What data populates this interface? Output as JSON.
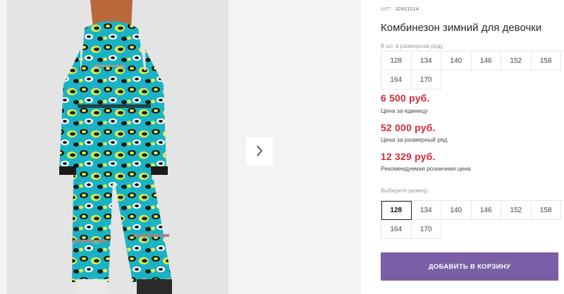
{
  "product": {
    "sku_label": "АРТ:",
    "sku_value": "32421014",
    "title": "Комбинезон зимний для девочки"
  },
  "pack_sizes": {
    "label": "В шт. в размерном ряду",
    "sizes": [
      "128",
      "134",
      "140",
      "146",
      "152",
      "158",
      "164",
      "170"
    ]
  },
  "prices": {
    "unit_price": "6 500 руб.",
    "unit_caption": "Цена за единицу",
    "row_price": "52 000 руб.",
    "row_caption": "Цена за размерный ряд",
    "retail_price": "12 329 руб.",
    "retail_caption": "Рекомендуемая розничная цена"
  },
  "size_select": {
    "label": "Выберите размер:",
    "selected": "128",
    "sizes": [
      "128",
      "134",
      "140",
      "146",
      "152",
      "158",
      "164",
      "170"
    ]
  },
  "cart": {
    "button_label": "ДОБАВИТЬ В КОРЗИНУ"
  },
  "gallery": {
    "next_icon": "chevron-right-icon"
  },
  "colors": {
    "price": "#d42a3a",
    "cart_button": "#7a5fa6",
    "print_teal": "#1bb3c4",
    "print_yellow": "#dff04a",
    "print_black": "#1a1a1a"
  }
}
